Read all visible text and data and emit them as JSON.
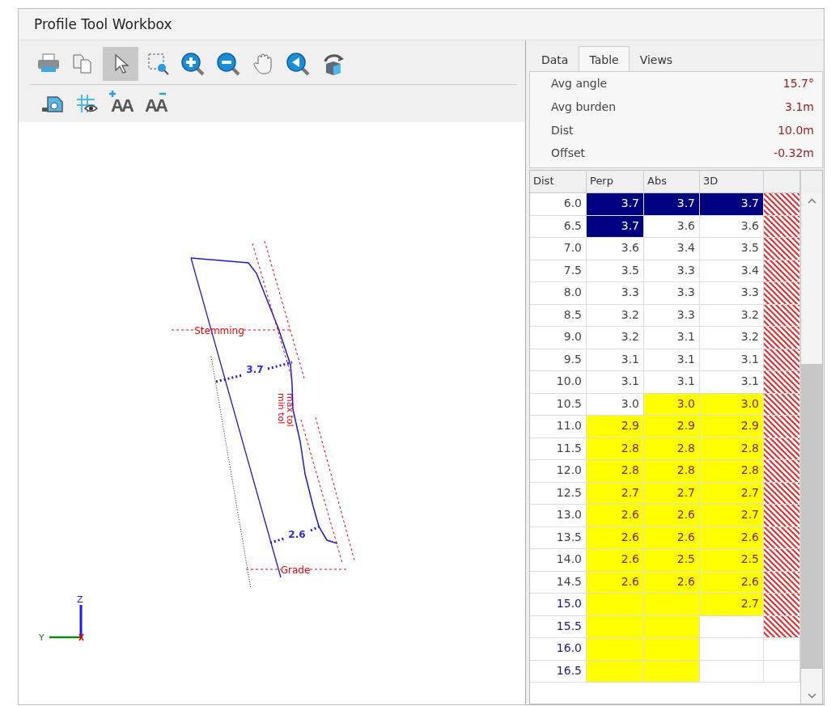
{
  "window": {
    "title": "Profile Tool Workbox"
  },
  "toolbar": {
    "rows": [
      [
        {
          "kind": "print",
          "selected": false
        },
        {
          "kind": "copy",
          "selected": false
        },
        {
          "kind": "pointer",
          "selected": true
        },
        {
          "kind": "zoom_box",
          "selected": false
        },
        {
          "kind": "zoom_in",
          "selected": false
        },
        {
          "kind": "zoom_out",
          "selected": false
        },
        {
          "kind": "pan",
          "selected": false
        },
        {
          "kind": "zoom_back",
          "selected": false
        },
        {
          "kind": "rotate",
          "selected": false
        }
      ],
      [
        {
          "kind": "box",
          "selected": false
        },
        {
          "kind": "grid_eye",
          "selected": false
        },
        {
          "kind": "text_larger",
          "glyph": "AA",
          "selected": false
        },
        {
          "kind": "text_smaller",
          "glyph": "AA",
          "selected": false
        }
      ]
    ]
  },
  "profile": {
    "stemming_label": "Stemming",
    "grade_label": "Grade",
    "burden_labels": [
      "3.7",
      "2.6"
    ],
    "tolerance_labels": [
      "max tol",
      "min tol"
    ],
    "axes": {
      "z": "Z",
      "y": "Y"
    }
  },
  "tabs": [
    {
      "label": "Data",
      "selected": false
    },
    {
      "label": "Table",
      "selected": true
    },
    {
      "label": "Views",
      "selected": false
    }
  ],
  "summary": [
    {
      "label": "Avg angle",
      "value": "15.7°"
    },
    {
      "label": "Avg burden",
      "value": "3.1m"
    },
    {
      "label": "Dist",
      "value": "10.0m"
    },
    {
      "label": "Offset",
      "value": "-0.32m"
    }
  ],
  "table": {
    "columns": [
      "Dist",
      "Perp",
      "Abs",
      "3D"
    ],
    "rows": [
      {
        "dist": "6.0",
        "flagged": false,
        "hatched": true,
        "cells": [
          {
            "value": "3.7",
            "selected": true,
            "warning": false
          },
          {
            "value": "3.7",
            "selected": true,
            "warning": false
          },
          {
            "value": "3.7",
            "selected": true,
            "warning": false
          }
        ]
      },
      {
        "dist": "6.5",
        "flagged": false,
        "hatched": true,
        "cells": [
          {
            "value": "3.7",
            "selected": true,
            "warning": false
          },
          {
            "value": "3.6",
            "selected": false,
            "warning": false
          },
          {
            "value": "3.6",
            "selected": false,
            "warning": false
          }
        ]
      },
      {
        "dist": "7.0",
        "flagged": false,
        "hatched": true,
        "cells": [
          {
            "value": "3.6",
            "selected": false,
            "warning": false
          },
          {
            "value": "3.4",
            "selected": false,
            "warning": false
          },
          {
            "value": "3.5",
            "selected": false,
            "warning": false
          }
        ]
      },
      {
        "dist": "7.5",
        "flagged": false,
        "hatched": true,
        "cells": [
          {
            "value": "3.5",
            "selected": false,
            "warning": false
          },
          {
            "value": "3.3",
            "selected": false,
            "warning": false
          },
          {
            "value": "3.4",
            "selected": false,
            "warning": false
          }
        ]
      },
      {
        "dist": "8.0",
        "flagged": false,
        "hatched": true,
        "cells": [
          {
            "value": "3.3",
            "selected": false,
            "warning": false
          },
          {
            "value": "3.3",
            "selected": false,
            "warning": false
          },
          {
            "value": "3.3",
            "selected": false,
            "warning": false
          }
        ]
      },
      {
        "dist": "8.5",
        "flagged": false,
        "hatched": true,
        "cells": [
          {
            "value": "3.2",
            "selected": false,
            "warning": false
          },
          {
            "value": "3.3",
            "selected": false,
            "warning": false
          },
          {
            "value": "3.2",
            "selected": false,
            "warning": false
          }
        ]
      },
      {
        "dist": "9.0",
        "flagged": false,
        "hatched": true,
        "cells": [
          {
            "value": "3.2",
            "selected": false,
            "warning": false
          },
          {
            "value": "3.1",
            "selected": false,
            "warning": false
          },
          {
            "value": "3.2",
            "selected": false,
            "warning": false
          }
        ]
      },
      {
        "dist": "9.5",
        "flagged": false,
        "hatched": true,
        "cells": [
          {
            "value": "3.1",
            "selected": false,
            "warning": false
          },
          {
            "value": "3.1",
            "selected": false,
            "warning": false
          },
          {
            "value": "3.1",
            "selected": false,
            "warning": false
          }
        ]
      },
      {
        "dist": "10.0",
        "flagged": false,
        "hatched": true,
        "cells": [
          {
            "value": "3.1",
            "selected": false,
            "warning": false
          },
          {
            "value": "3.1",
            "selected": false,
            "warning": false
          },
          {
            "value": "3.1",
            "selected": false,
            "warning": false
          }
        ]
      },
      {
        "dist": "10.5",
        "flagged": false,
        "hatched": true,
        "cells": [
          {
            "value": "3.0",
            "selected": false,
            "warning": false
          },
          {
            "value": "3.0",
            "selected": false,
            "warning": true
          },
          {
            "value": "3.0",
            "selected": false,
            "warning": true
          }
        ]
      },
      {
        "dist": "11.0",
        "flagged": false,
        "hatched": true,
        "cells": [
          {
            "value": "2.9",
            "selected": false,
            "warning": true
          },
          {
            "value": "2.9",
            "selected": false,
            "warning": true
          },
          {
            "value": "2.9",
            "selected": false,
            "warning": true
          }
        ]
      },
      {
        "dist": "11.5",
        "flagged": false,
        "hatched": true,
        "cells": [
          {
            "value": "2.8",
            "selected": false,
            "warning": true
          },
          {
            "value": "2.8",
            "selected": false,
            "warning": true
          },
          {
            "value": "2.8",
            "selected": false,
            "warning": true
          }
        ]
      },
      {
        "dist": "12.0",
        "flagged": false,
        "hatched": true,
        "cells": [
          {
            "value": "2.8",
            "selected": false,
            "warning": true
          },
          {
            "value": "2.8",
            "selected": false,
            "warning": true
          },
          {
            "value": "2.8",
            "selected": false,
            "warning": true
          }
        ]
      },
      {
        "dist": "12.5",
        "flagged": false,
        "hatched": true,
        "cells": [
          {
            "value": "2.7",
            "selected": false,
            "warning": true
          },
          {
            "value": "2.7",
            "selected": false,
            "warning": true
          },
          {
            "value": "2.7",
            "selected": false,
            "warning": true
          }
        ]
      },
      {
        "dist": "13.0",
        "flagged": false,
        "hatched": true,
        "cells": [
          {
            "value": "2.6",
            "selected": false,
            "warning": true
          },
          {
            "value": "2.6",
            "selected": false,
            "warning": true
          },
          {
            "value": "2.7",
            "selected": false,
            "warning": true
          }
        ]
      },
      {
        "dist": "13.5",
        "flagged": false,
        "hatched": true,
        "cells": [
          {
            "value": "2.6",
            "selected": false,
            "warning": true
          },
          {
            "value": "2.6",
            "selected": false,
            "warning": true
          },
          {
            "value": "2.6",
            "selected": false,
            "warning": true
          }
        ]
      },
      {
        "dist": "14.0",
        "flagged": false,
        "hatched": true,
        "cells": [
          {
            "value": "2.6",
            "selected": false,
            "warning": true
          },
          {
            "value": "2.5",
            "selected": false,
            "warning": true
          },
          {
            "value": "2.5",
            "selected": false,
            "warning": true
          }
        ]
      },
      {
        "dist": "14.5",
        "flagged": false,
        "hatched": true,
        "cells": [
          {
            "value": "2.6",
            "selected": false,
            "warning": true
          },
          {
            "value": "2.6",
            "selected": false,
            "warning": true
          },
          {
            "value": "2.6",
            "selected": false,
            "warning": true
          }
        ]
      },
      {
        "dist": "15.0",
        "flagged": true,
        "hatched": true,
        "cells": [
          {
            "selected": false,
            "warning": true
          },
          {
            "selected": false,
            "warning": true
          },
          {
            "value": "2.7",
            "selected": false,
            "warning": true
          }
        ]
      },
      {
        "dist": "15.5",
        "flagged": true,
        "hatched": true,
        "cells": [
          {
            "selected": false,
            "warning": true
          },
          {
            "selected": false,
            "warning": true
          },
          {
            "selected": false,
            "warning": false
          }
        ]
      },
      {
        "dist": "16.0",
        "flagged": true,
        "hatched": false,
        "cells": [
          {
            "selected": false,
            "warning": true
          },
          {
            "selected": false,
            "warning": true
          },
          {
            "selected": false,
            "warning": false
          }
        ]
      },
      {
        "dist": "16.5",
        "flagged": true,
        "hatched": false,
        "cells": [
          {
            "selected": false,
            "warning": true
          },
          {
            "selected": false,
            "warning": true
          },
          {
            "selected": false,
            "warning": false
          }
        ]
      }
    ]
  }
}
